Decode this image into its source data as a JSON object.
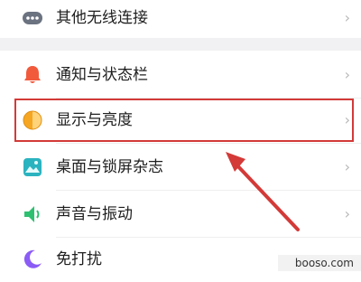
{
  "settings": {
    "items": [
      {
        "label": "其他无线连接",
        "icon": "more-dots-icon",
        "color": "#6b7280"
      },
      {
        "label": "通知与状态栏",
        "icon": "bell-icon",
        "color": "#f25a3c"
      },
      {
        "label": "显示与亮度",
        "icon": "brightness-icon",
        "color": "#f5a623"
      },
      {
        "label": "桌面与锁屏杂志",
        "icon": "wallpaper-icon",
        "color": "#2bb3c0"
      },
      {
        "label": "声音与振动",
        "icon": "speaker-icon",
        "color": "#2fbf71"
      },
      {
        "label": "免打扰",
        "icon": "moon-icon",
        "color": "#8b5cf6"
      }
    ],
    "chevron": "›",
    "highlighted_item": "显示与亮度"
  },
  "annotation": {
    "highlight_color": "#d33a38",
    "arrow_color": "#d33a38"
  },
  "watermark": {
    "text": "booso.com"
  }
}
